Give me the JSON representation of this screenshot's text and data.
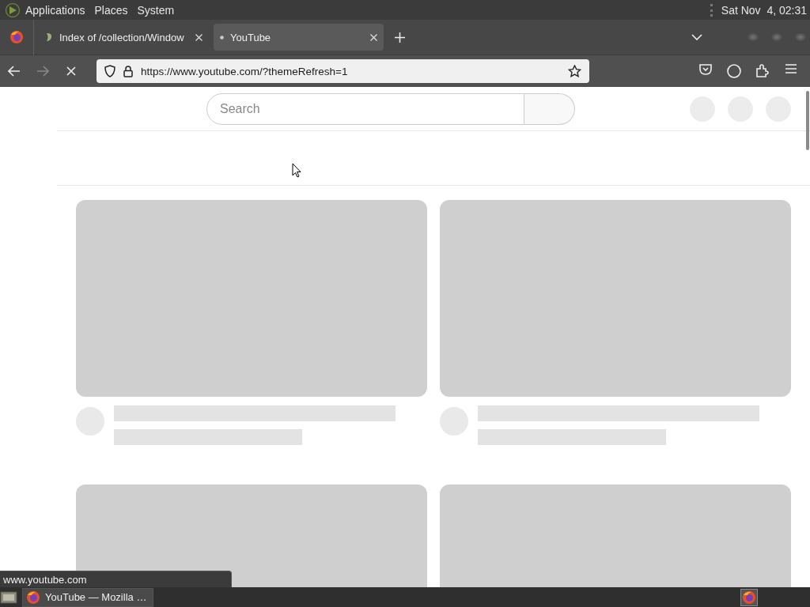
{
  "top_panel": {
    "menus": [
      "Applications",
      "Places",
      "System"
    ],
    "clock": "Sat Nov  4, 02:31"
  },
  "tabs": [
    {
      "title": "Index of /collection/Window",
      "selected": false
    },
    {
      "title": "YouTube",
      "selected": true
    }
  ],
  "address_bar": {
    "url": "https://www.youtube.com/?themeRefresh=1"
  },
  "page": {
    "search": {
      "placeholder": "Search"
    },
    "video_cards": [
      {
        "kind": "skeleton"
      },
      {
        "kind": "skeleton"
      },
      {
        "kind": "thumbnail"
      },
      {
        "kind": "thumbnail"
      }
    ]
  },
  "status_link": "www.youtube.com",
  "taskbar": {
    "windows": [
      {
        "title": "YouTube — Mozilla …",
        "selected": true
      }
    ]
  }
}
